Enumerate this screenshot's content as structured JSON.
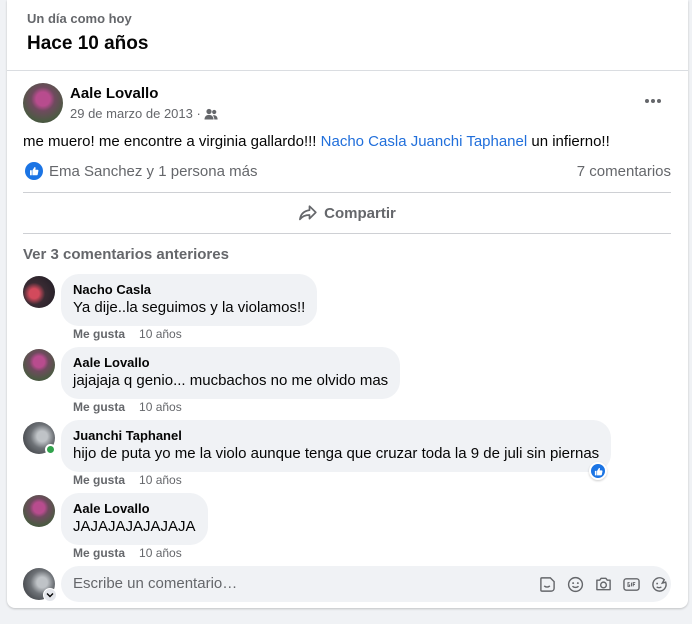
{
  "memory": {
    "subtitle": "Un día como hoy",
    "title": "Hace 10 años"
  },
  "post": {
    "author": "Aale Lovallo",
    "date": "29 de marzo de 2013",
    "separator": "·",
    "text_before": "me muero! me encontre a virginia gallardo!!! ",
    "mention_1": "Nacho Casla",
    "mention_2": "Juanchi Taphanel",
    "text_after": " un infierno!!",
    "reactions_text": "Ema Sanchez y 1 persona más",
    "comment_count": "7 comentarios",
    "share_label": "Compartir"
  },
  "comments_section": {
    "previous_label": "Ver 3 comentarios anteriores",
    "like_label": "Me gusta",
    "items": [
      {
        "name": "Nacho Casla",
        "text": "Ya dije..la seguimos y la violamos!!",
        "time": "10 años"
      },
      {
        "name": "Aale Lovallo",
        "text": "jajajaja q genio... mucbachos no me olvido mas",
        "time": "10 años"
      },
      {
        "name": "Juanchi Taphanel",
        "text": "hijo de puta yo me la violo aunque tenga que cruzar toda la 9 de juli sin piernas",
        "time": "10 años"
      },
      {
        "name": "Aale Lovallo",
        "text": "JAJAJAJAJAJAJA",
        "time": "10 años"
      }
    ]
  },
  "composer": {
    "placeholder": "Escribe un comentario…"
  },
  "colors": {
    "link": "#216fdb",
    "like_blue": "#1b74e4",
    "secondary_text": "#65676b",
    "online": "#31a24c"
  },
  "icons": [
    "friends-audience-icon",
    "more-options-icon",
    "like-reaction-icon",
    "share-arrow-icon",
    "sticker-icon",
    "emoji-icon",
    "camera-icon",
    "gif-icon",
    "avatar-sticker-icon",
    "chevron-down-icon"
  ]
}
